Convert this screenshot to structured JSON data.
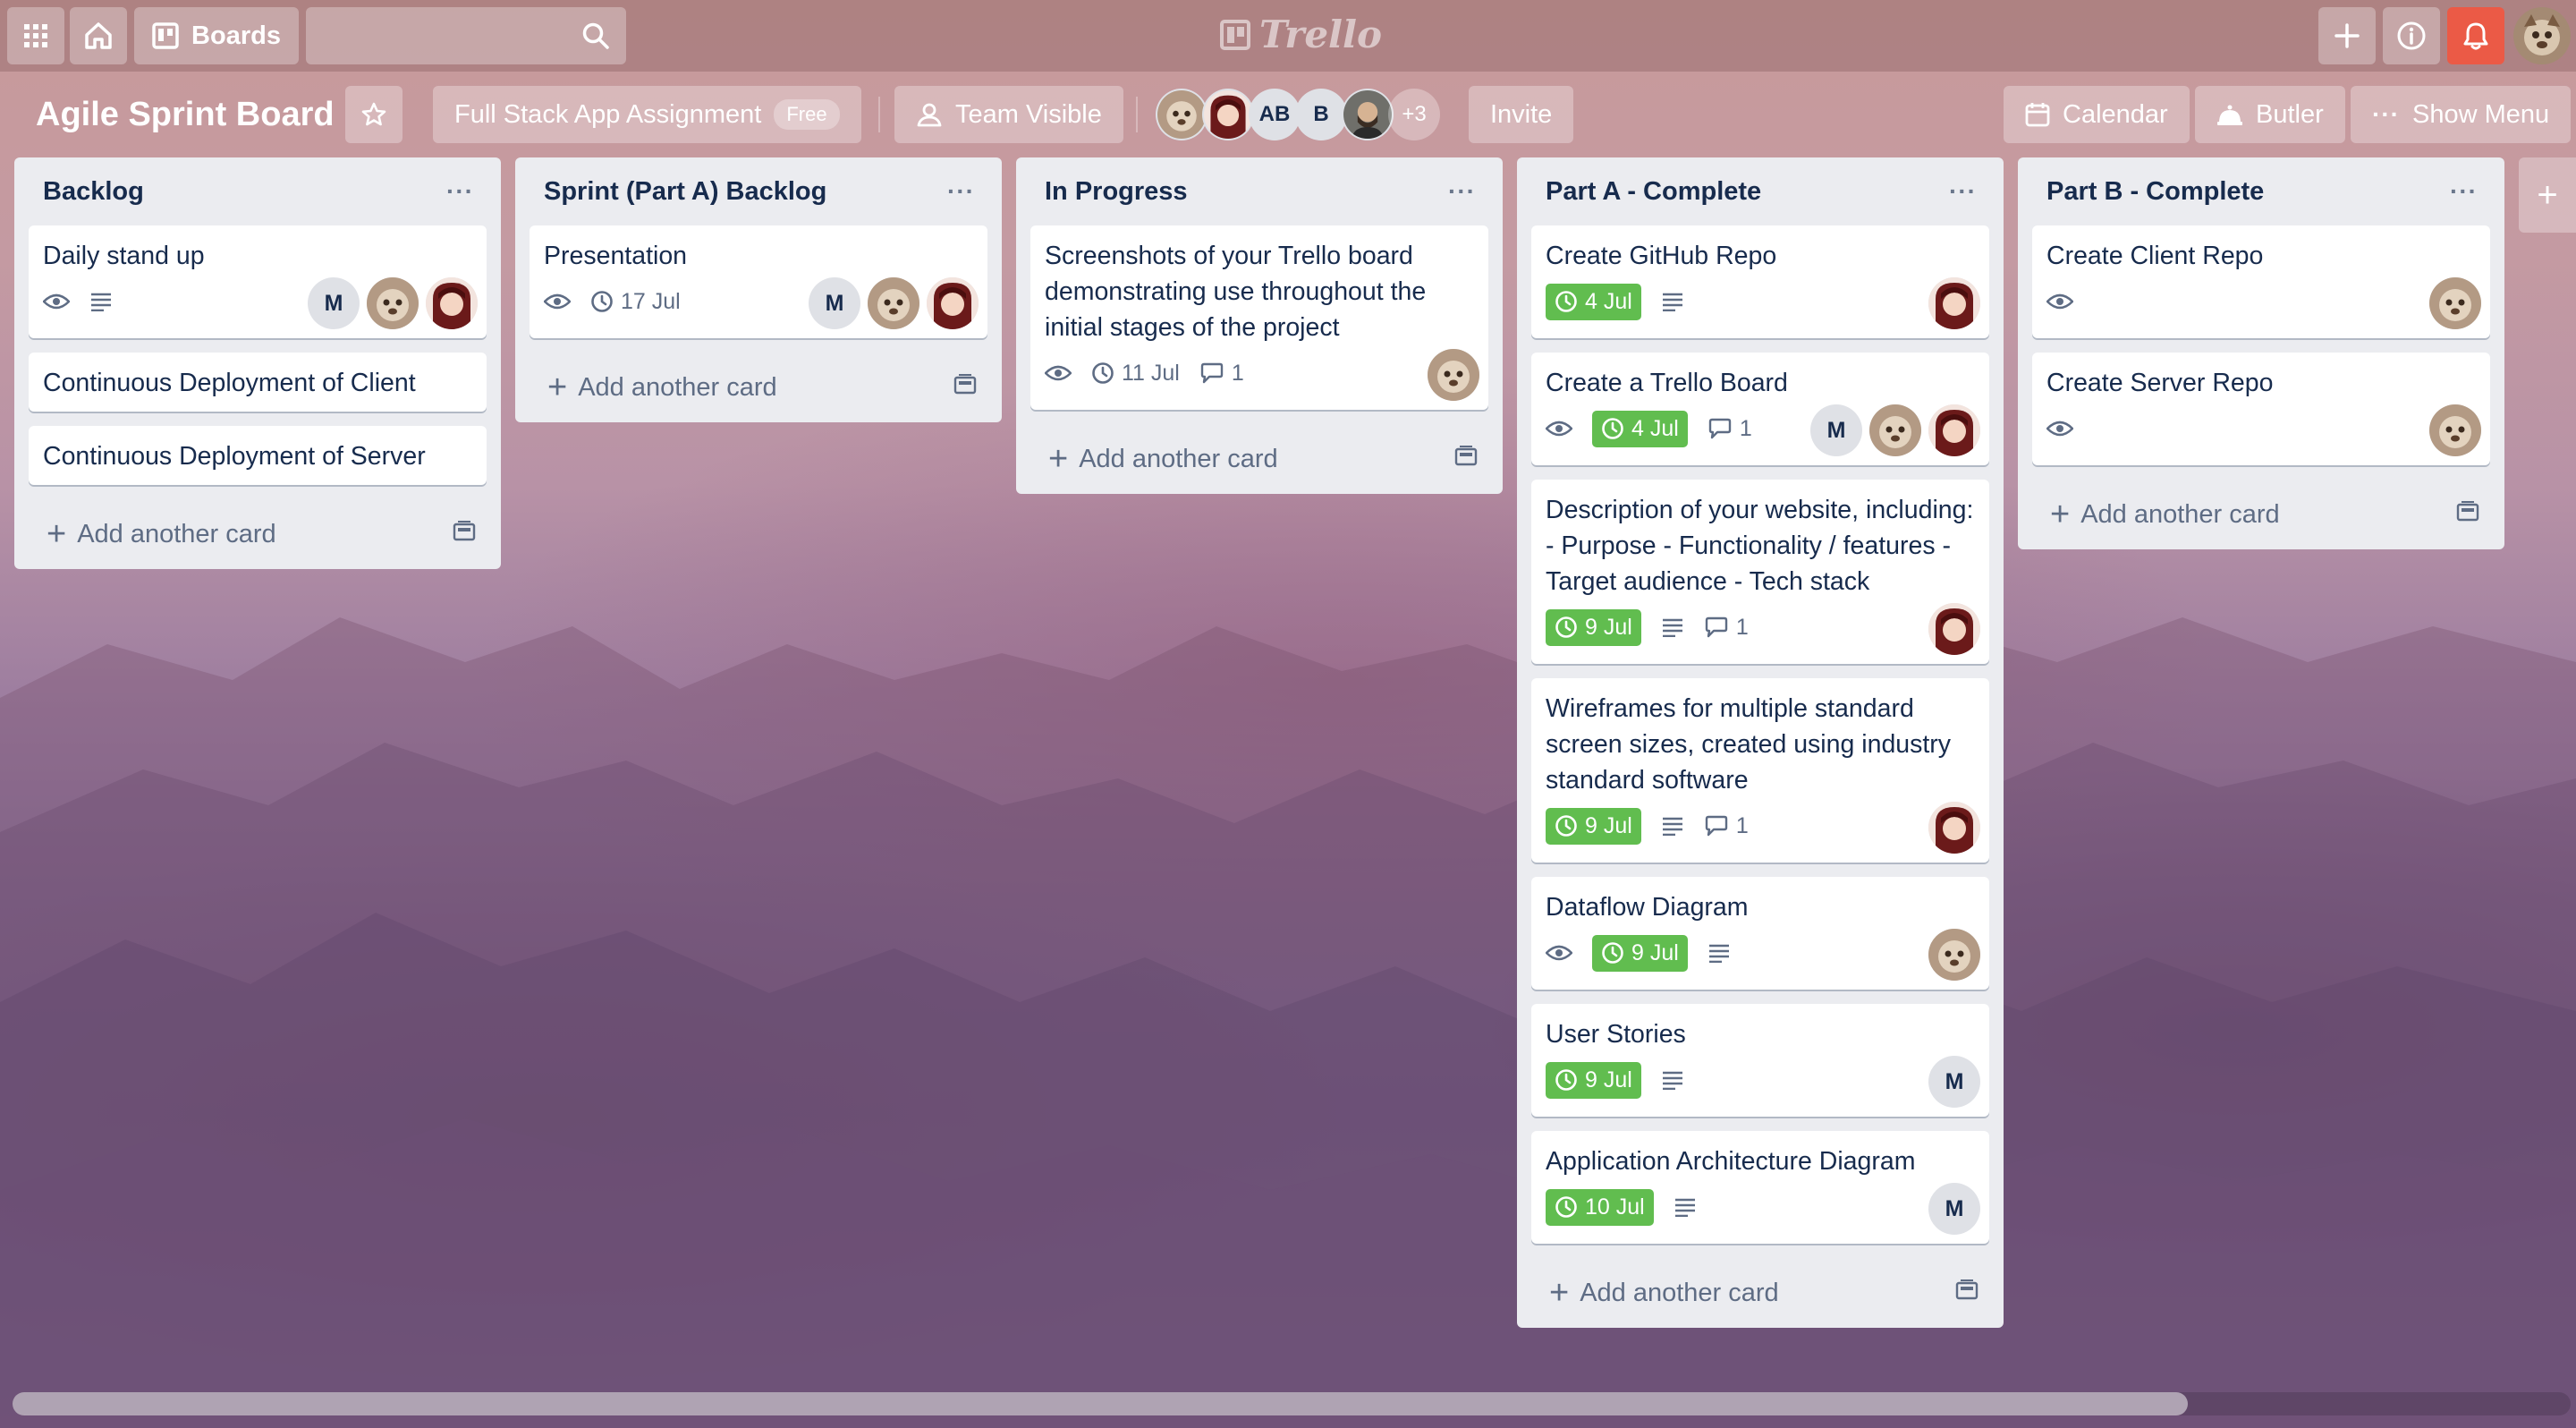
{
  "nav": {
    "boards_label": "Boards",
    "search_placeholder": "",
    "logo_text": "Trello"
  },
  "board": {
    "title": "Agile Sprint Board",
    "team_name": "Full Stack App Assignment",
    "plan_badge": "Free",
    "visibility": "Team Visible",
    "members": [
      "AB",
      "B"
    ],
    "members_more": "+3",
    "invite_label": "Invite",
    "calendar_label": "Calendar",
    "butler_label": "Butler",
    "show_menu_label": "Show Menu"
  },
  "colors": {
    "due_complete": "#61bd4f",
    "notification": "#eb5a46",
    "list_bg": "#ebecf0",
    "text": "#172b4d"
  },
  "lists": [
    {
      "title": "Backlog",
      "cards": [
        {
          "title": "Daily stand up",
          "watch": true,
          "description": true,
          "members": [
            "M"
          ]
        },
        {
          "title": "Continuous Deployment of Client"
        },
        {
          "title": "Continuous Deployment of Server"
        }
      ],
      "add_label": "Add another card"
    },
    {
      "title": "Sprint (Part A) Backlog",
      "cards": [
        {
          "title": "Presentation",
          "watch": true,
          "due": "17 Jul",
          "members": [
            "M"
          ]
        }
      ],
      "add_label": "Add another card"
    },
    {
      "title": "In Progress",
      "cards": [
        {
          "title": "Screenshots of your Trello board demonstrating use throughout the initial stages of the project",
          "watch": true,
          "due": "11 Jul",
          "comments": "1"
        }
      ],
      "add_label": "Add another card"
    },
    {
      "title": "Part A - Complete",
      "cards": [
        {
          "title": "Create GitHub Repo",
          "due": "4 Jul",
          "due_complete": true,
          "description": true
        },
        {
          "title": "Create a Trello Board",
          "watch": true,
          "due": "4 Jul",
          "due_complete": true,
          "comments": "1",
          "members": [
            "M"
          ]
        },
        {
          "title": "Description of your website, including: - Purpose - Functionality / features - Target audience - Tech stack",
          "due": "9 Jul",
          "due_complete": true,
          "description": true,
          "comments": "1"
        },
        {
          "title": "Wireframes for multiple standard screen sizes, created using industry standard software",
          "due": "9 Jul",
          "due_complete": true,
          "description": true,
          "comments": "1"
        },
        {
          "title": "Dataflow Diagram",
          "watch": true,
          "due": "9 Jul",
          "due_complete": true,
          "description": true
        },
        {
          "title": "User Stories",
          "due": "9 Jul",
          "due_complete": true,
          "description": true,
          "members": [
            "M"
          ]
        },
        {
          "title": "Application Architecture Diagram",
          "due": "10 Jul",
          "due_complete": true,
          "description": true,
          "members": [
            "M"
          ]
        }
      ],
      "add_label": "Add another card"
    },
    {
      "title": "Part B - Complete",
      "cards": [
        {
          "title": "Create Client Repo",
          "watch": true
        },
        {
          "title": "Create Server Repo",
          "watch": true
        }
      ],
      "add_label": "Add another card"
    }
  ],
  "icons": {
    "apps": "grid-icon",
    "home": "home-icon",
    "boards": "boards-icon",
    "search": "search-icon",
    "create": "plus-icon",
    "info": "info-icon",
    "notifications": "bell-icon",
    "star": "star-icon",
    "calendar": "calendar-icon",
    "butler": "butler-icon",
    "watch": "eye-icon",
    "due": "clock-icon",
    "description": "description-icon",
    "comments": "comment-icon",
    "template": "card-template-icon"
  }
}
